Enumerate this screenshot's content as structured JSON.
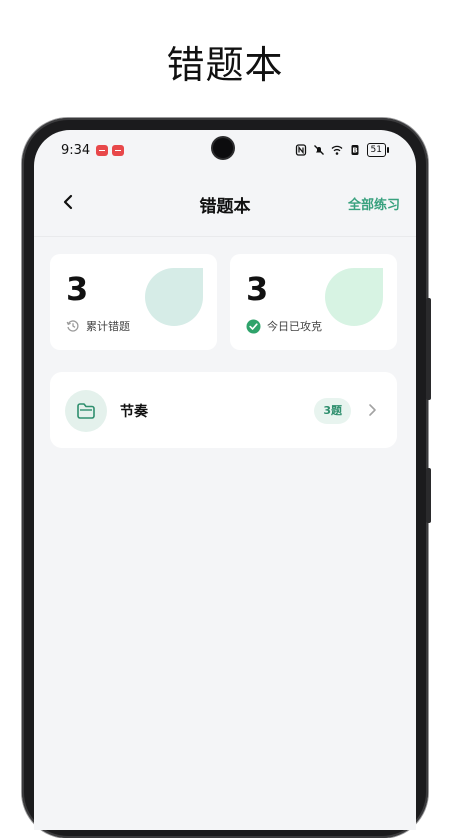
{
  "promo": {
    "title": "错题本"
  },
  "status_bar": {
    "time": "9:34",
    "battery": "51"
  },
  "nav": {
    "title": "错题本",
    "action_label": "全部练习"
  },
  "summary": [
    {
      "count": "3",
      "label": "累计错题",
      "icon": "history-icon",
      "accent": "#d6ece7"
    },
    {
      "count": "3",
      "label": "今日已攻克",
      "icon": "check-circle-icon",
      "accent": "#d7f3e3"
    }
  ],
  "list": [
    {
      "title": "节奏",
      "badge": "3题",
      "icon": "folder-icon"
    }
  ],
  "colors": {
    "brand": "#38a17e",
    "check": "#2fa36b",
    "background": "#f4f5f7"
  }
}
